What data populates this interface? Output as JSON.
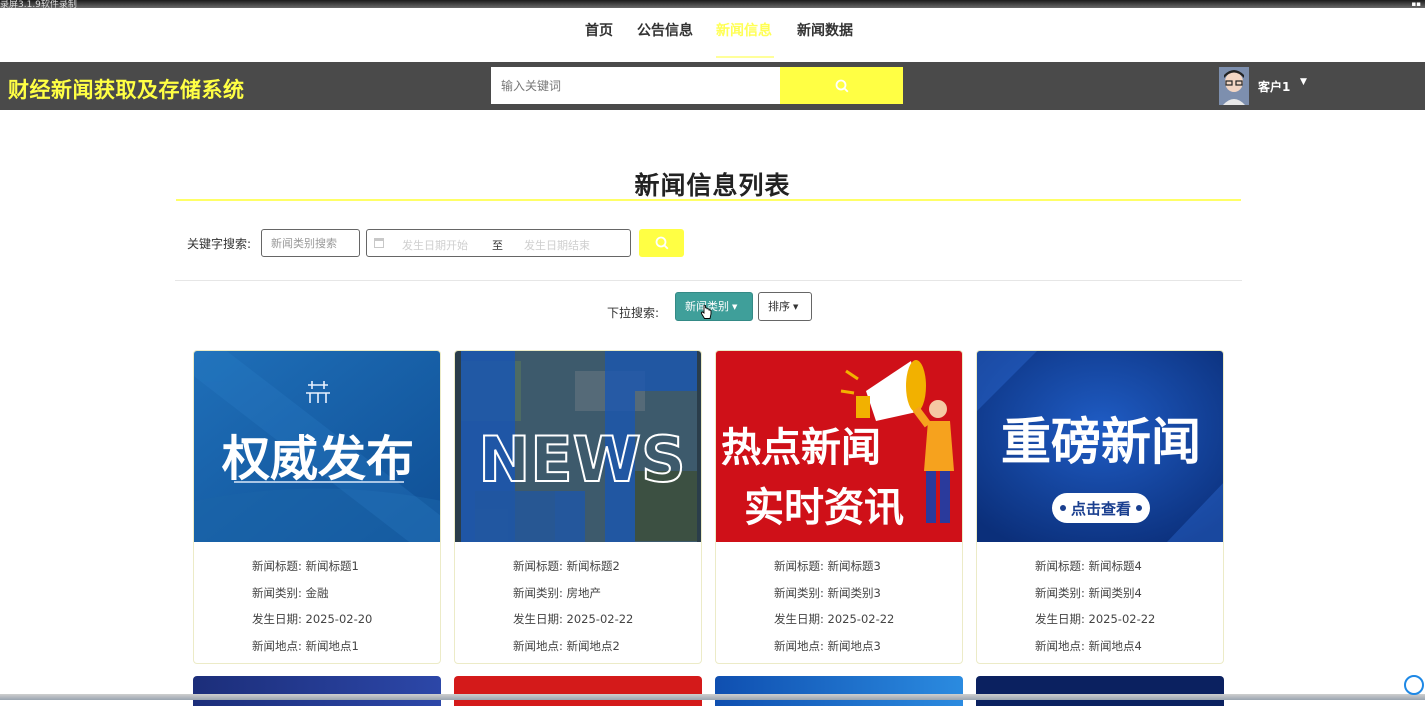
{
  "recorder": {
    "title": "录屏3.1.9软件录制"
  },
  "nav": {
    "items": [
      {
        "label": "首页",
        "active": false
      },
      {
        "label": "公告信息",
        "active": false
      },
      {
        "label": "新闻信息",
        "active": true
      },
      {
        "label": "新闻数据",
        "active": false
      }
    ]
  },
  "header": {
    "site_title": "财经新闻获取及存储系统",
    "search_placeholder": "输入关键词",
    "user_name": "客户1",
    "accent_color": "#ffff44",
    "bar_color": "#4a4a4a"
  },
  "page": {
    "title": "新闻信息列表",
    "keyword_label": "关键字搜索:",
    "keyword_placeholder": "新闻类别搜索",
    "date_start_placeholder": "发生日期开始",
    "date_sep": "至",
    "date_end_placeholder": "发生日期结束",
    "dropdown_label": "下拉搜索:",
    "category_button": "新闻类别",
    "sort_button": "排序"
  },
  "cards": [
    {
      "image_text": "权威发布",
      "title_label": "新闻标题:",
      "title": "新闻标题1",
      "category_label": "新闻类别:",
      "category": "金融",
      "date_label": "发生日期:",
      "date": "2025-02-20",
      "place_label": "新闻地点:",
      "place": "新闻地点1"
    },
    {
      "image_text": "NEWS",
      "title_label": "新闻标题:",
      "title": "新闻标题2",
      "category_label": "新闻类别:",
      "category": "房地产",
      "date_label": "发生日期:",
      "date": "2025-02-22",
      "place_label": "新闻地点:",
      "place": "新闻地点2"
    },
    {
      "image_text_1": "热点新闻",
      "image_text_2": "实时资讯",
      "title_label": "新闻标题:",
      "title": "新闻标题3",
      "category_label": "新闻类别:",
      "category": "新闻类别3",
      "date_label": "发生日期:",
      "date": "2025-02-22",
      "place_label": "新闻地点:",
      "place": "新闻地点3"
    },
    {
      "image_text": "重磅新闻",
      "image_button": "点击查看",
      "title_label": "新闻标题:",
      "title": "新闻标题4",
      "category_label": "新闻类别:",
      "category": "新闻类别4",
      "date_label": "发生日期:",
      "date": "2025-02-22",
      "place_label": "新闻地点:",
      "place": "新闻地点4"
    }
  ]
}
